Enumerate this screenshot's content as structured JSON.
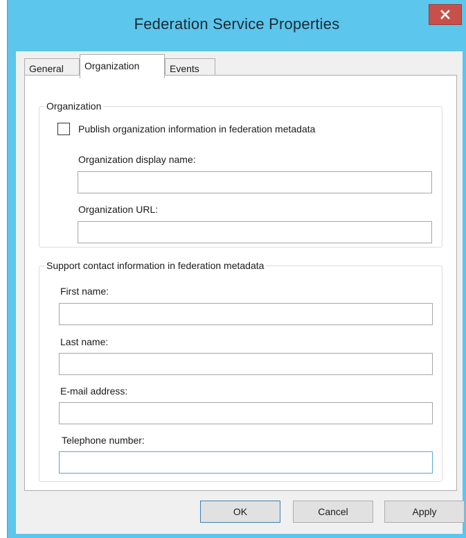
{
  "window": {
    "title": "Federation Service Properties"
  },
  "tabs": [
    {
      "label": "General",
      "active": false
    },
    {
      "label": "Organization",
      "active": true
    },
    {
      "label": "Events",
      "active": false
    }
  ],
  "organization_group": {
    "title": "Organization",
    "publish_checkbox": {
      "label": "Publish organization information in federation metadata",
      "checked": false
    },
    "display_name": {
      "label": "Organization display name:",
      "value": ""
    },
    "url": {
      "label": "Organization URL:",
      "value": ""
    }
  },
  "support_group": {
    "title": "Support contact information in federation metadata",
    "first_name": {
      "label": "First name:",
      "value": ""
    },
    "last_name": {
      "label": "Last name:",
      "value": ""
    },
    "email": {
      "label": "E-mail address:",
      "value": ""
    },
    "telephone": {
      "label": "Telephone number:",
      "value": ""
    }
  },
  "buttons": {
    "ok": "OK",
    "cancel": "Cancel",
    "apply": "Apply"
  },
  "colors": {
    "titlebar": "#5cc6ec",
    "close_button": "#c7514a",
    "dialog_background": "#f0f0f0",
    "focus_border": "#5aa6d6"
  },
  "icons": {
    "close": "close-icon"
  }
}
